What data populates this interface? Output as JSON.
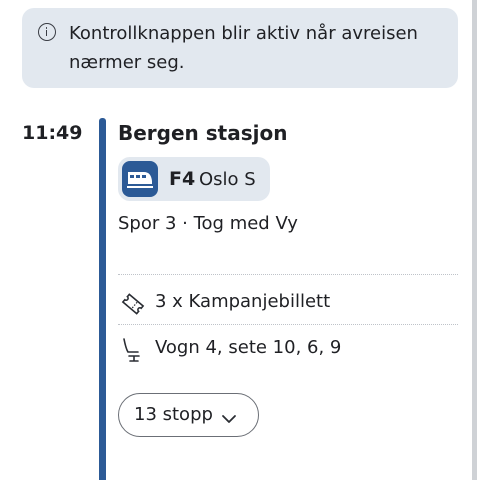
{
  "info_banner": {
    "text": "Kontrollknappen blir aktiv når avreisen nærmer seg.",
    "icon": "info-icon"
  },
  "departure": {
    "time": "11:49",
    "station": "Bergen stasjon",
    "line": {
      "code": "F4",
      "destination": "Oslo S",
      "icon": "train-icon",
      "color": "#2c5a96"
    },
    "track_info": "Spor 3 · Tog med Vy"
  },
  "ticket": {
    "icon": "ticket-icon",
    "text": "3 x Kampanjebillett"
  },
  "seat": {
    "icon": "seat-icon",
    "text": "Vogn 4, sete 10, 6, 9"
  },
  "stops_button": {
    "label": "13 stopp",
    "icon": "chevron-down-icon"
  },
  "colors": {
    "accent": "#2c5a96",
    "banner_bg": "#e2e8ef"
  }
}
